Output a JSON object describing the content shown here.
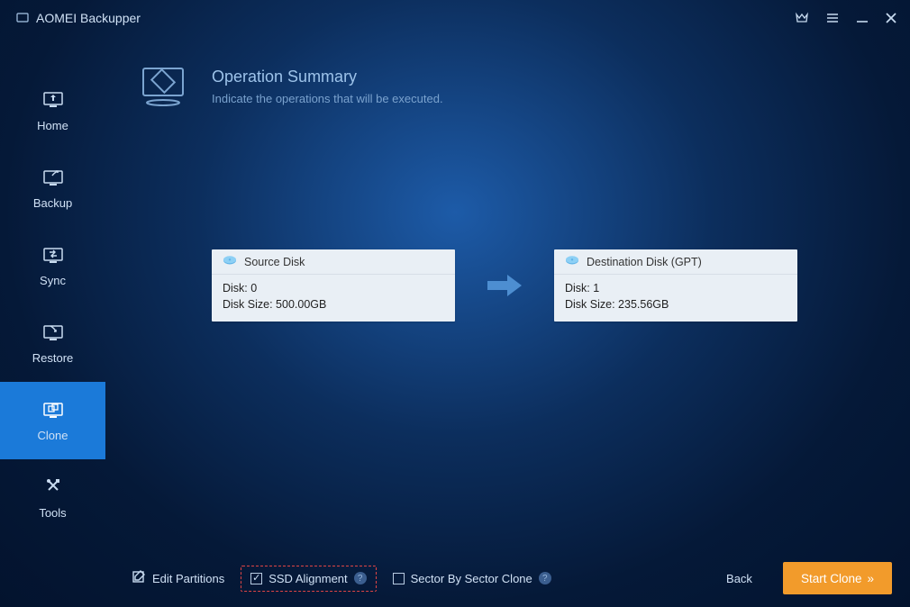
{
  "app": {
    "title": "AOMEI Backupper"
  },
  "sidebar": {
    "items": [
      {
        "label": "Home"
      },
      {
        "label": "Backup"
      },
      {
        "label": "Sync"
      },
      {
        "label": "Restore"
      },
      {
        "label": "Clone"
      },
      {
        "label": "Tools"
      }
    ],
    "activeIndex": 4
  },
  "header": {
    "title": "Operation Summary",
    "subtitle": "Indicate the operations that will be executed."
  },
  "source": {
    "heading": "Source Disk",
    "line1": "Disk: 0",
    "line2": "Disk Size: 500.00GB"
  },
  "dest": {
    "heading": "Destination Disk (GPT)",
    "line1": "Disk: 1",
    "line2": "Disk Size: 235.56GB"
  },
  "footer": {
    "editPartitions": "Edit Partitions",
    "ssdAlignment": "SSD Alignment",
    "sectorClone": "Sector By Sector Clone",
    "back": "Back",
    "start": "Start Clone"
  }
}
